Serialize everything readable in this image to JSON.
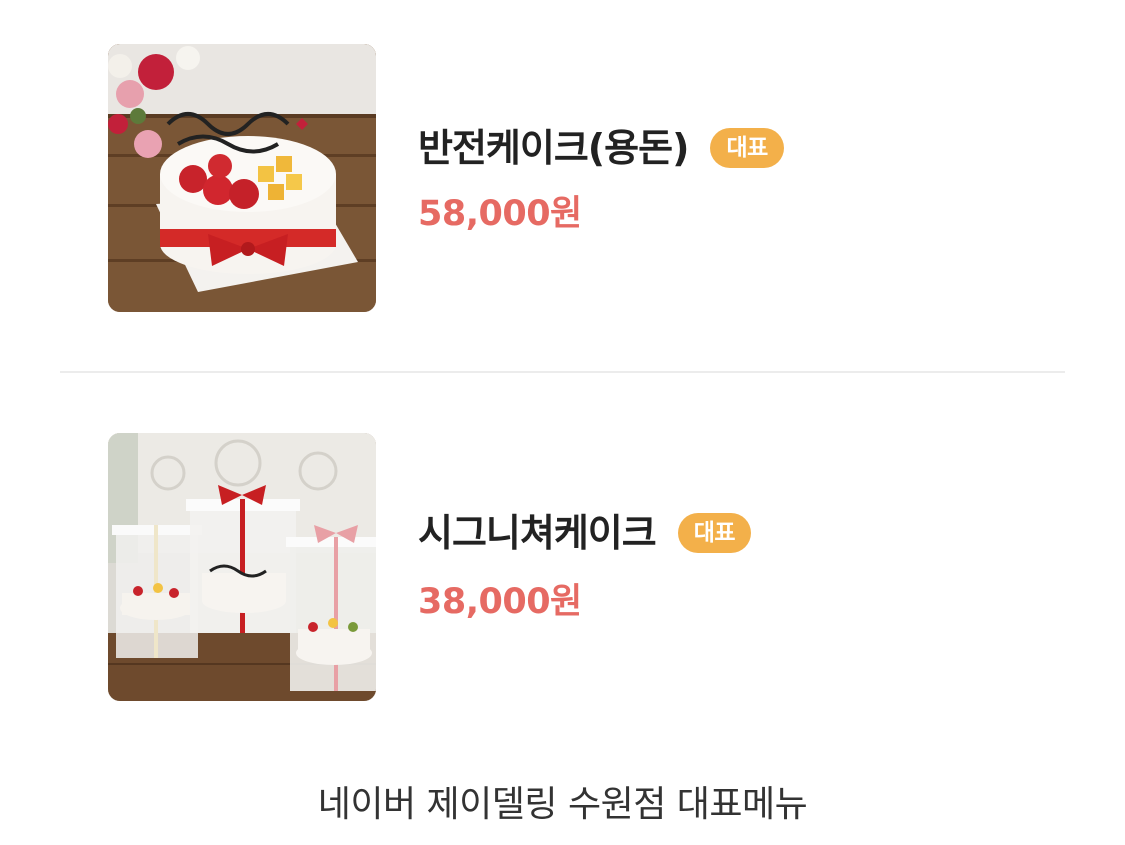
{
  "menu": {
    "items": [
      {
        "name": "반전케이크(용돈)",
        "badge": "대표",
        "price": "58,000원",
        "image_icon": "cake-photo-icon"
      },
      {
        "name": "시그니쳐케이크",
        "badge": "대표",
        "price": "38,000원",
        "image_icon": "cake-photo-icon"
      }
    ]
  },
  "caption": "네이버 제이델링 수원점 대표메뉴",
  "colors": {
    "badge_bg": "#f3b04a",
    "price": "#e66a63",
    "name": "#222222",
    "divider": "#ececec"
  }
}
